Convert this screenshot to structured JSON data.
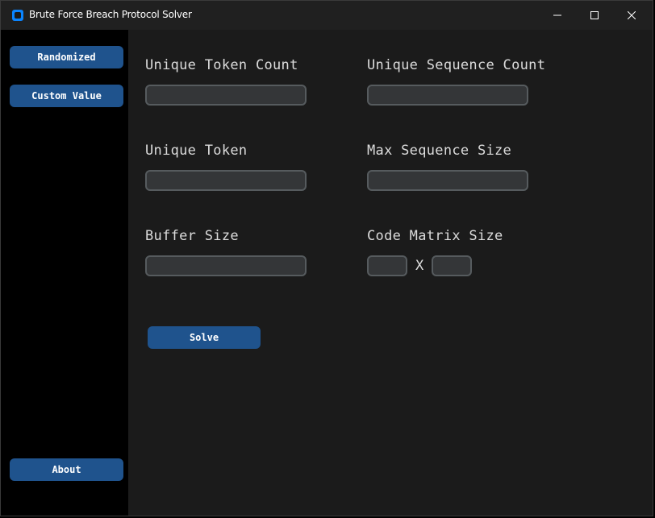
{
  "window": {
    "title": "Brute Force Breach Protocol Solver",
    "accent_color": "#1f538d"
  },
  "sidebar": {
    "randomized_label": "Randomized",
    "custom_value_label": "Custom Value",
    "about_label": "About"
  },
  "form": {
    "unique_token_count_label": "Unique Token Count",
    "unique_token_count_value": "",
    "unique_sequence_count_label": "Unique Sequence Count",
    "unique_sequence_count_value": "",
    "unique_token_label": "Unique Token",
    "unique_token_value": "",
    "max_sequence_size_label": "Max Sequence Size",
    "max_sequence_size_value": "",
    "buffer_size_label": "Buffer Size",
    "buffer_size_value": "",
    "code_matrix_size_label": "Code Matrix Size",
    "code_matrix_rows_value": "",
    "code_matrix_cols_value": "",
    "matrix_separator": "X",
    "solve_label": "Solve"
  }
}
